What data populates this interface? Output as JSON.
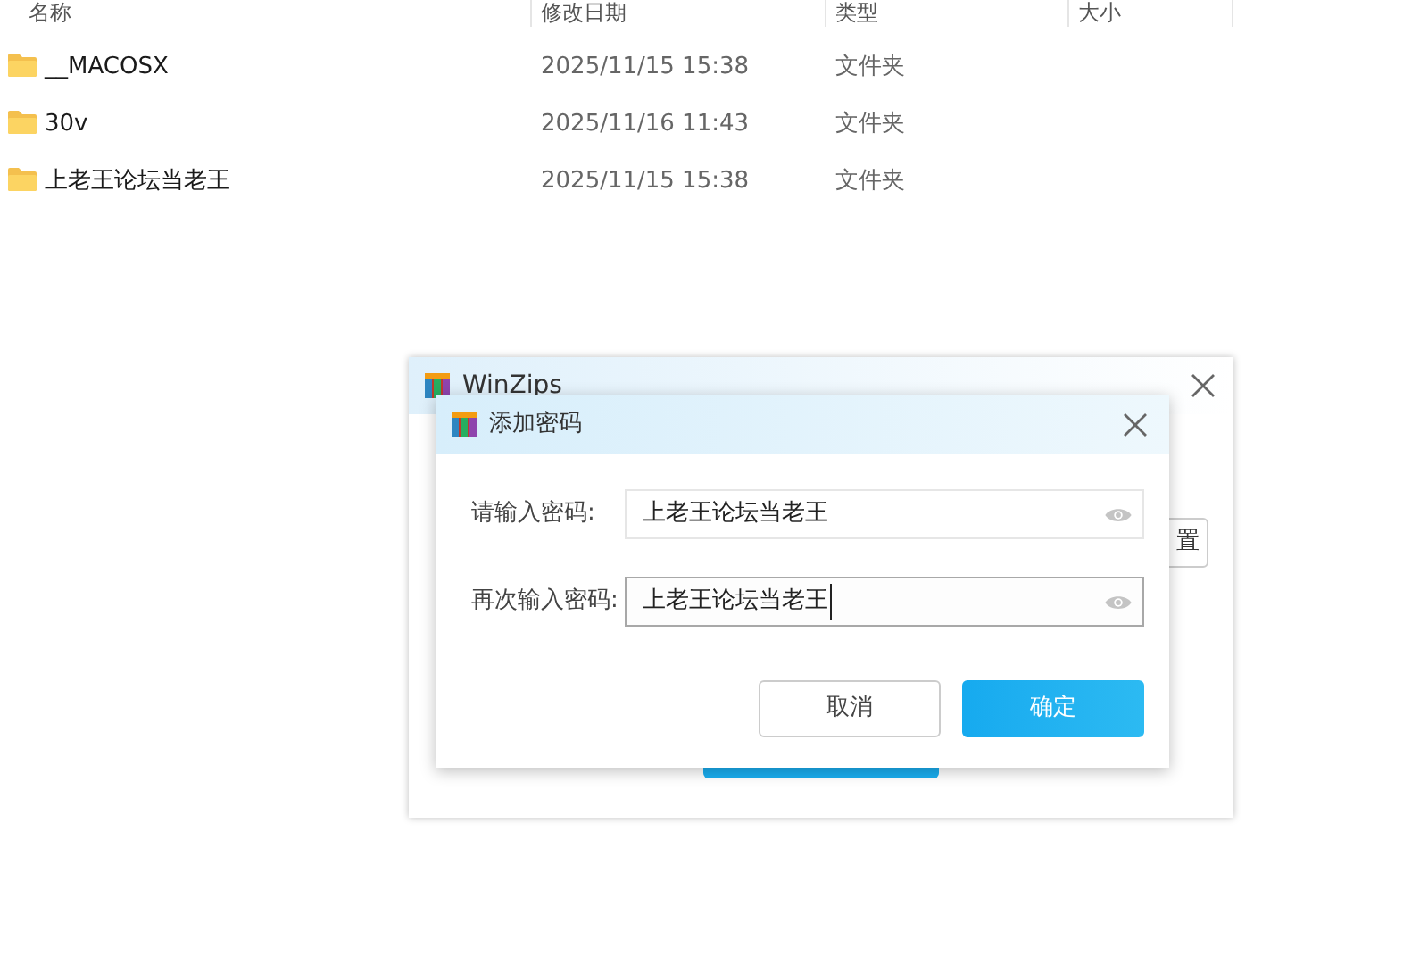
{
  "file_list": {
    "columns": [
      "名称",
      "修改日期",
      "类型",
      "大小"
    ],
    "rows": [
      {
        "name": "__MACOSX",
        "modified": "2025/11/15 15:38",
        "type": "文件夹"
      },
      {
        "name": "30v",
        "modified": "2025/11/16 11:43",
        "type": "文件夹"
      },
      {
        "name": "上老王论坛当老王",
        "modified": "2025/11/15 15:38",
        "type": "文件夹"
      }
    ]
  },
  "back_window": {
    "title": "WinZips",
    "side_button": "置"
  },
  "dialog": {
    "title": "添加密码",
    "fields": [
      {
        "label": "请输入密码:",
        "value": "上老王论坛当老王",
        "focused": false
      },
      {
        "label": "再次输入密码:",
        "value": "上老王论坛当老王",
        "focused": true
      }
    ],
    "buttons": [
      {
        "label": "取消",
        "kind": "secondary"
      },
      {
        "label": "确定",
        "kind": "primary"
      }
    ]
  }
}
